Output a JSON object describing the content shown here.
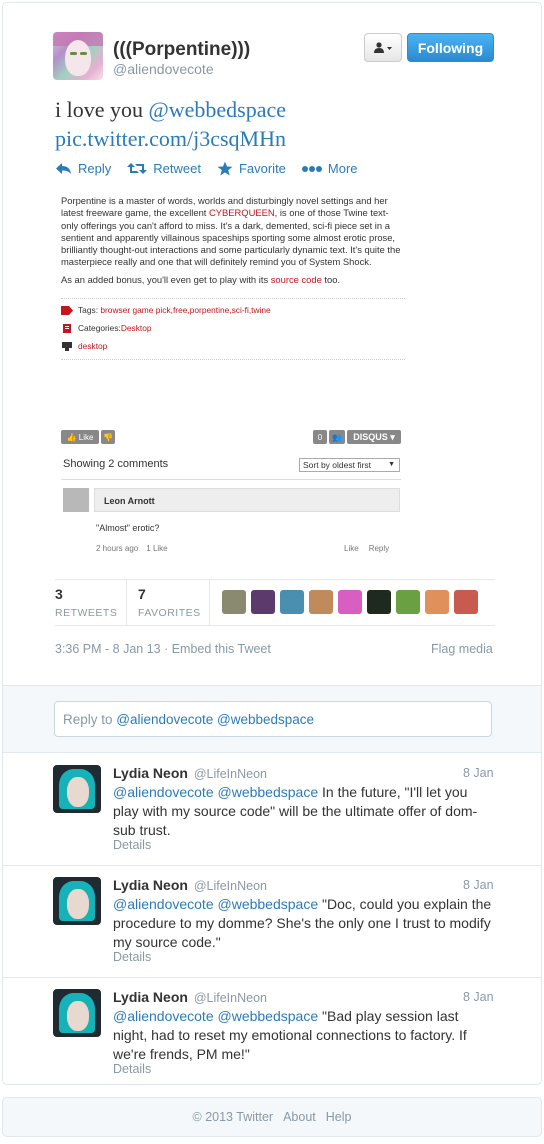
{
  "author": {
    "name": "(((Porpentine)))",
    "handle": "@aliendovecote"
  },
  "buttons": {
    "follow_label": "Following",
    "user_menu_icon": "person-dropdown-icon"
  },
  "tweet": {
    "text_prefix": "i love you ",
    "mention": "@webbedspace",
    "pic_link": "pic.twitter.com/j3csqMHn"
  },
  "actions": {
    "reply": "Reply",
    "retweet": "Retweet",
    "favorite": "Favorite",
    "more": "More"
  },
  "media": {
    "p1_a": "Porpentine is a master of words, worlds and disturbingly novel settings and her latest freeware game, the excellent ",
    "p1_link": "CYBERQUEEN",
    "p1_b": ", is one of those Twine text-only offerings you can't afford to miss. It's a dark, demented, sci-fi piece set in a sentient and apparently villainous spaceships sporting some almost erotic prose, brilliantly thought-out interactions and some particularly dynamic text. It's quite the masterpiece really and one that will definitely remind you of System Shock.",
    "p2_a": "As an added bonus, you'll even get to play with its ",
    "p2_link": "source code",
    "p2_b": " too.",
    "tags_label": "Tags: ",
    "tags_value": "browser game pick,free,porpentine,sci-fi,twine",
    "categories_label": "Categories: ",
    "categories_value": "Desktop",
    "desktop_tag": "desktop"
  },
  "disqus": {
    "like": "Like",
    "count": "0",
    "brand": "DISQUS",
    "comments_label": "Showing 2 comments",
    "sort_label": "Sort by oldest first",
    "comment_author": "Leon Arnott",
    "comment_body": "\"Almost\" erotic?",
    "comment_time": "2 hours ago",
    "comment_likes": "1 Like",
    "like_action": "Like",
    "reply_action": "Reply"
  },
  "stats": {
    "retweets_count": "3",
    "retweets_label": "RETWEETS",
    "favorites_count": "7",
    "favorites_label": "FAVORITES"
  },
  "favoriters": [
    "#8a8a70",
    "#5c3a6b",
    "#4a8fb0",
    "#c08a5a",
    "#d85fc2",
    "#1f2a1f",
    "#6aa040",
    "#e0905a",
    "#c85a50"
  ],
  "timestamp": "3:36 PM - 8 Jan 13 · Embed this Tweet",
  "flag_media": "Flag media",
  "reply_box": {
    "prefix": "Reply to ",
    "mentions": "@aliendovecote @webbedspace"
  },
  "replies": [
    {
      "name": "Lydia Neon",
      "handle": "@LifeInNeon",
      "date": "8 Jan",
      "mentions": "@aliendovecote @webbedspace",
      "text": " In the future, \"I'll let you play with my source code\" will be the ultimate offer of dom-sub trust.",
      "details": "Details"
    },
    {
      "name": "Lydia Neon",
      "handle": "@LifeInNeon",
      "date": "8 Jan",
      "mentions": "@aliendovecote @webbedspace",
      "text": " \"Doc, could you explain the procedure to my domme? She's the only one I trust to modify my source code.\"",
      "details": "Details"
    },
    {
      "name": "Lydia Neon",
      "handle": "@LifeInNeon",
      "date": "8 Jan",
      "mentions": "@aliendovecote @webbedspace",
      "text": " \"Bad play session last night, had to reset my emotional connections to factory. If we're frends, PM me!\"",
      "details": "Details"
    }
  ],
  "footer": {
    "copyright": "© 2013 Twitter",
    "about": "About",
    "help": "Help"
  }
}
